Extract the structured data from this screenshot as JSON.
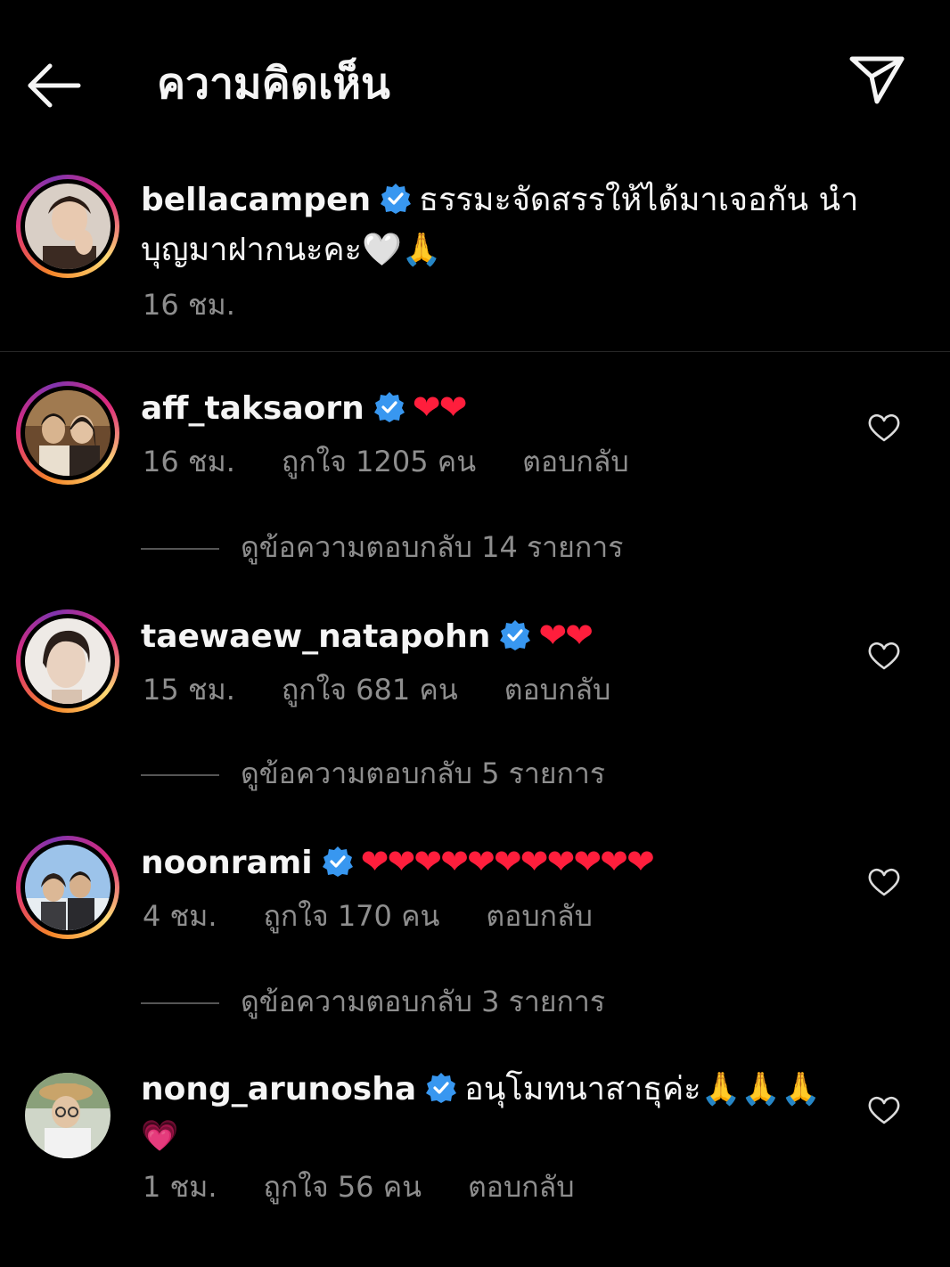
{
  "header": {
    "title": "ความคิดเห็น"
  },
  "caption": {
    "username": "bellacampen",
    "text_line1": "ธรรมะจัดสรรให้ได้มาเจอกัน นำ",
    "text_line2": "บุญมาฝากนะคะ🤍🙏",
    "time": "16 ชม."
  },
  "comments": [
    {
      "username": "aff_taksaorn",
      "text": "❤❤",
      "time": "16 ชม.",
      "likes": "ถูกใจ 1205 คน",
      "reply": "ตอบกลับ",
      "view_replies": "ดูข้อความตอบกลับ 14 รายการ"
    },
    {
      "username": "taewaew_natapohn",
      "text": "❤❤",
      "time": "15 ชม.",
      "likes": "ถูกใจ 681 คน",
      "reply": "ตอบกลับ",
      "view_replies": "ดูข้อความตอบกลับ 5 รายการ"
    },
    {
      "username": "noonrami",
      "text": "❤❤❤❤❤❤❤❤❤❤❤",
      "time": "4 ชม.",
      "likes": "ถูกใจ 170 คน",
      "reply": "ตอบกลับ",
      "view_replies": "ดูข้อความตอบกลับ 3 รายการ"
    },
    {
      "username": "nong_arunosha",
      "text": "อนุโมทนาสาธุค่ะ🙏🙏🙏",
      "text_line2": "💗",
      "time": "1 ชม.",
      "likes": "ถูกใจ 56 คน",
      "reply": "ตอบกลับ"
    }
  ],
  "colors": {
    "background": "#000000",
    "text": "#f5f5f5",
    "secondary": "#8e8e8e",
    "verified": "#3897f0",
    "heart": "#ff1e3c"
  }
}
